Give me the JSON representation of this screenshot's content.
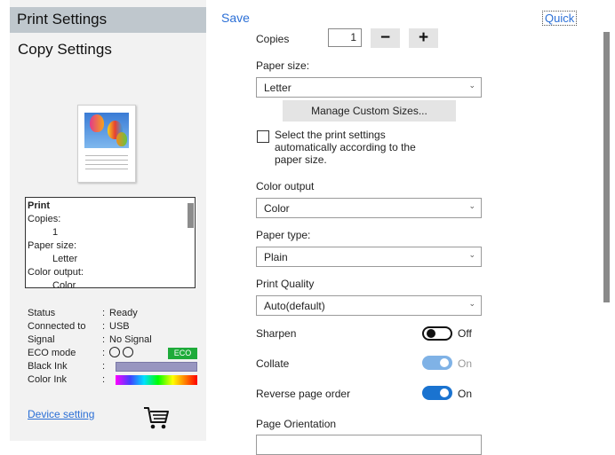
{
  "left": {
    "title": "Print Settings",
    "subtitle": "Copy Settings",
    "summary": {
      "heading": "Print",
      "lines": [
        {
          "text": "Copies:",
          "indent": 0
        },
        {
          "text": "1",
          "indent": 1
        },
        {
          "text": "Paper size:",
          "indent": 0
        },
        {
          "text": "Letter",
          "indent": 1
        },
        {
          "text": "Color output:",
          "indent": 0
        },
        {
          "text": "Color",
          "indent": 1
        }
      ]
    },
    "status": {
      "status_label": "Status",
      "status_value": "Ready",
      "connected_label": "Connected to",
      "connected_value": "USB",
      "signal_label": "Signal",
      "signal_value": "No Signal",
      "eco_label": "ECO  mode",
      "eco_badge": "ECO",
      "black_ink_label": "Black Ink",
      "color_ink_label": "Color Ink",
      "separator": ":"
    },
    "device_setting": "Device setting"
  },
  "right": {
    "save": "Save",
    "quick": "Quick",
    "copies_label": "Copies",
    "copies_value": "1",
    "minus": "−",
    "plus": "+",
    "paper_size_label": "Paper size:",
    "paper_size_value": "Letter",
    "manage_custom_sizes": "Manage Custom Sizes...",
    "auto_select_text": "Select the print settings automatically according to the paper size.",
    "color_output_label": "Color output",
    "color_output_value": "Color",
    "paper_type_label": "Paper type:",
    "paper_type_value": "Plain",
    "print_quality_label": "Print Quality",
    "print_quality_value": "Auto(default)",
    "sharpen_label": "Sharpen",
    "sharpen_state": "Off",
    "collate_label": "Collate",
    "collate_state": "On",
    "reverse_label": "Reverse page order",
    "reverse_state": "On",
    "orientation_label": "Page Orientation"
  },
  "colors": {
    "link": "#2b6fd6",
    "toggle_on": "#1a73d0",
    "toggle_disabled": "#7fb2e6",
    "eco_green": "#1eab3a",
    "title_bar": "#bfc7cd"
  }
}
